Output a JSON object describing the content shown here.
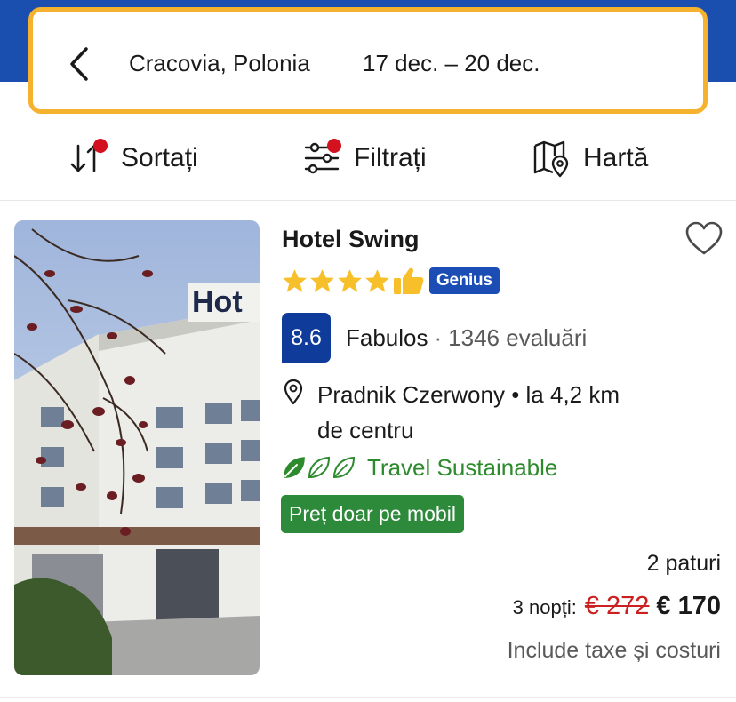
{
  "colors": {
    "brand_blue": "#1a4fb0",
    "search_border": "#f4b22e",
    "badge_red": "#d4111e",
    "score_bg": "#0f3c9b",
    "genius_bg": "#1b4db5",
    "sustainable_green": "#2d8a2d",
    "mobile_badge_bg": "#2d8a3a",
    "old_price_red": "#cc1f1f",
    "star_yellow": "#f7bf2a"
  },
  "search": {
    "back_icon": "chevron-left-icon",
    "location": "Cracovia, Polonia",
    "dates": "17 dec.  –  20 dec."
  },
  "toolbar": {
    "sort_label": "Sortați",
    "sort_icon": "sort-arrows-icon",
    "filter_label": "Filtrați",
    "filter_icon": "sliders-icon",
    "map_label": "Hartă",
    "map_icon": "map-pin-icon"
  },
  "hotel": {
    "name": "Hotel Swing",
    "photo_sign": "Hot",
    "stars": 4,
    "genius_label": "Genius",
    "score": "8.6",
    "score_word": "Fabulos",
    "score_separator": "·",
    "reviews": "1346 evaluări",
    "location_line1": "Pradnik Czerwony • la 4,2 km",
    "location_line2": "de centru",
    "sustainable_label": "Travel Sustainable",
    "sustainable_level": 1,
    "mobile_badge": "Preț doar pe mobil",
    "beds": "2 paturi",
    "nights": "3 nopți:",
    "old_price": "€ 272",
    "new_price": "€ 170",
    "taxes": "Include taxe și costuri"
  }
}
